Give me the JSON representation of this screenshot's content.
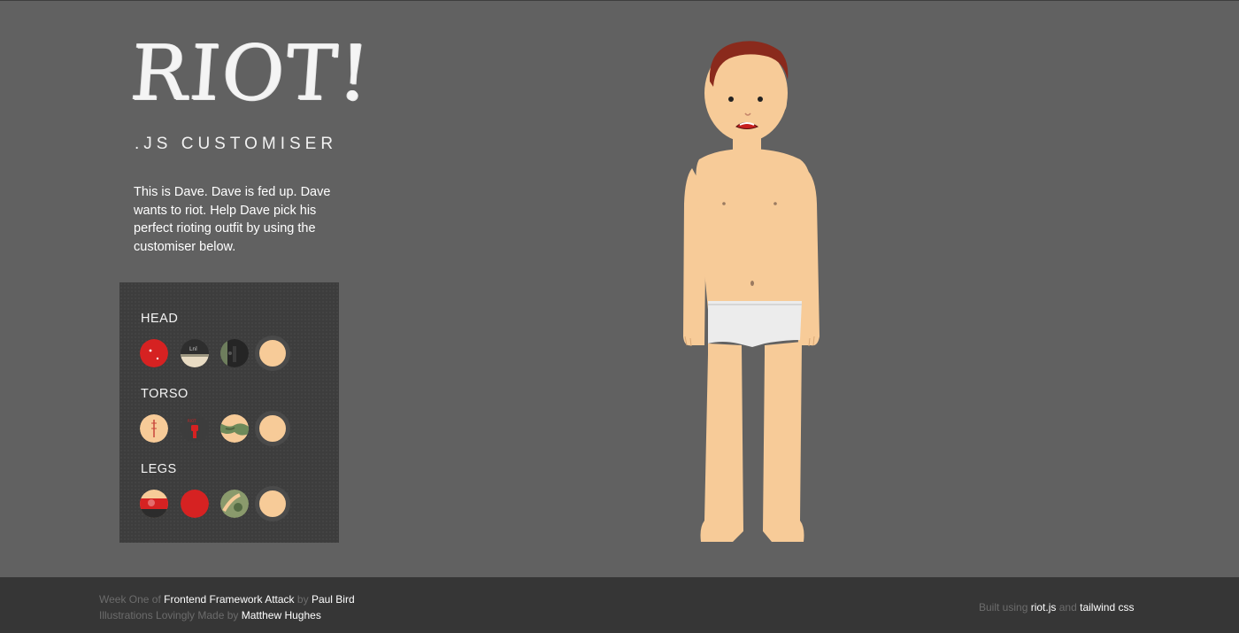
{
  "brand": {
    "logo_text": "RIOT!",
    "subtitle": ".JS CUSTOMISER"
  },
  "intro": {
    "text": "This is Dave. Dave is fed up. Dave wants to riot. Help Dave pick his perfect rioting outfit by using the customiser below."
  },
  "customiser": {
    "sections": [
      {
        "label": "HEAD",
        "options": [
          "red-hood-swatch",
          "cap-swatch",
          "gas-mask-swatch",
          "bare-head-swatch"
        ],
        "selected": "bare-head-swatch"
      },
      {
        "label": "TORSO",
        "options": [
          "striped-top-swatch",
          "fist-tshirt-swatch",
          "camo-top-swatch",
          "bare-torso-swatch"
        ],
        "selected": "bare-torso-swatch"
      },
      {
        "label": "LEGS",
        "options": [
          "shorts-swatch",
          "red-trousers-swatch",
          "camo-trousers-swatch",
          "bare-legs-swatch"
        ],
        "selected": "bare-legs-swatch"
      }
    ]
  },
  "footer": {
    "week_prefix": "Week One of",
    "project_link": "Frontend Framework Attack",
    "by_word": "by",
    "author_link": "Paul Bird",
    "illustrations_prefix": "Illustrations Lovingly Made by",
    "illustrator_link": "Matthew Hughes",
    "built_prefix": "Built using",
    "riot_link": "riot.js",
    "and_word": "and",
    "tailwind_link": "tailwind css"
  },
  "colors": {
    "background": "#616161",
    "panel": "#3d3d3d",
    "footer": "#363636",
    "skin": "#f7cb98",
    "accent_red": "#d62222"
  }
}
